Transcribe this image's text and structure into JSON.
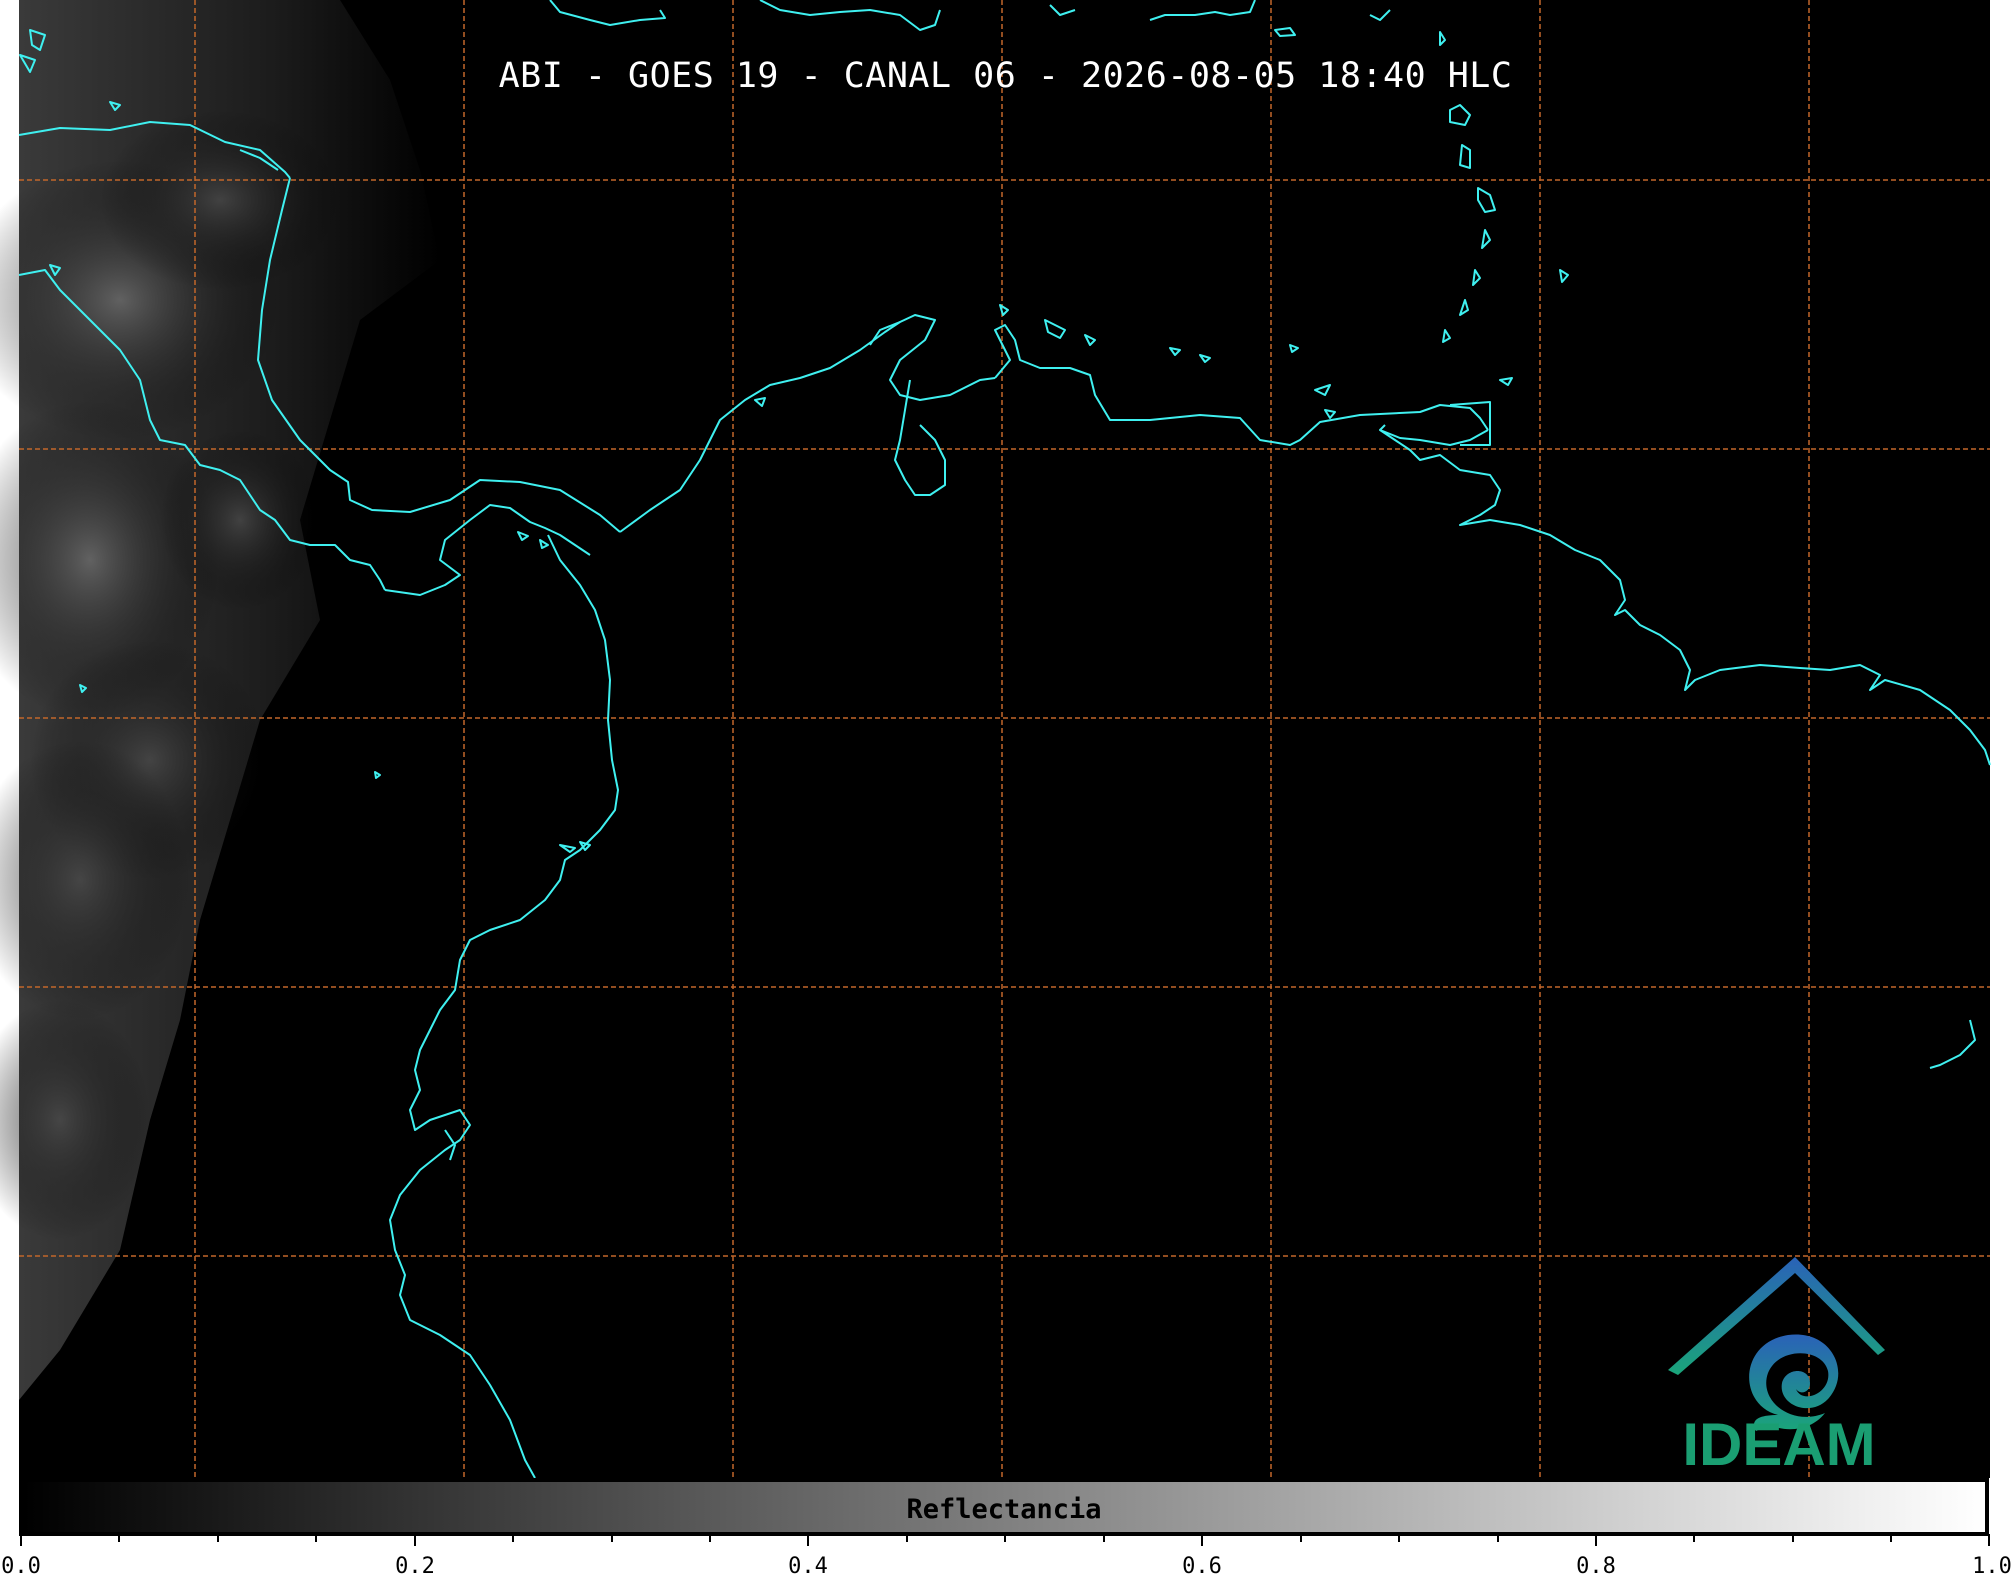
{
  "title": "ABI - GOES 19 - CANAL 06 - 2026-08-05 18:40 HLC",
  "map": {
    "background": "#000000",
    "coastline_color": "#3ff0f0",
    "grid_color": "#c2672a",
    "grid_style": "dashed"
  },
  "logo": {
    "text": "IDEAM",
    "icon": "ideam-logo",
    "colors": [
      "#2a62b8",
      "#1aa57a"
    ]
  },
  "colorbar": {
    "label": "Reflectancia",
    "min": 0.0,
    "max": 1.0,
    "colormap": [
      "#000000",
      "#ffffff"
    ],
    "tick_labels": [
      "0.0",
      "0.2",
      "0.4",
      "0.6",
      "0.8",
      "1.0"
    ]
  }
}
